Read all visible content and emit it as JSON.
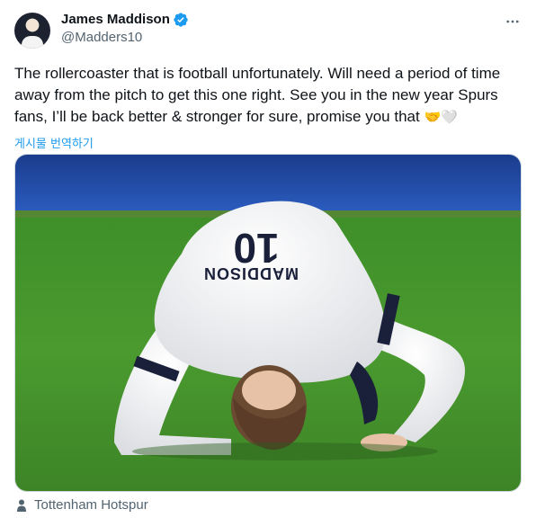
{
  "author": {
    "display_name": "James Maddison",
    "handle": "@Madders10",
    "verified": true
  },
  "tweet": {
    "text": "The rollercoaster that is football unfortunately. Will need a period of time away from the pitch to get this one right. See you in the new year Spurs fans, I’ll be back better & stronger for sure, promise you that",
    "emojis": "🤝🤍",
    "translate_label": "게시물 번역하기"
  },
  "media": {
    "shirt_number": "10",
    "shirt_name": "MADDISON"
  },
  "location": {
    "label": "Tottenham Hotspur"
  },
  "icons": {
    "more": "more-options-icon",
    "verified": "verified-badge-icon",
    "location": "person-icon"
  },
  "colors": {
    "accent": "#1d9bf0",
    "text": "#0f1419",
    "secondary": "#536471"
  }
}
